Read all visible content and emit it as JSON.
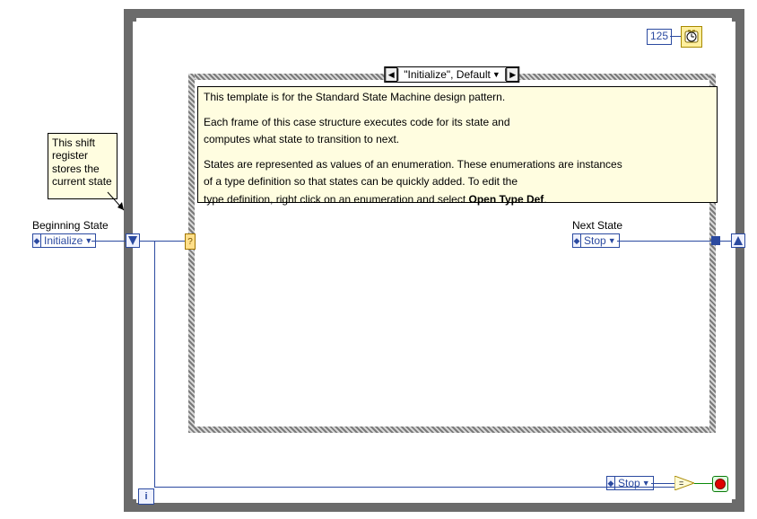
{
  "tip": {
    "text": "This shift register stores the current state"
  },
  "labels": {
    "beginning_state": "Beginning State",
    "next_state": "Next State"
  },
  "enums": {
    "beginning": "Initialize",
    "next": "Stop",
    "compare": "Stop"
  },
  "case_selector": {
    "text": "\"Initialize\", Default"
  },
  "help": {
    "line1": "This template is for the Standard State Machine design pattern.",
    "line2": "Each frame of this case structure executes code for its state and",
    "line3": "computes what state to transition to next.",
    "line4": "States are represented as values of an enumeration. These enumerations are instances",
    "line5": "of a type definition so that states can be quickly added. To edit the",
    "line6_a": "type definition, right click on an enumeration and select ",
    "line6_b": "Open Type Def",
    "line6_c": "."
  },
  "timer": {
    "ms": "125"
  },
  "iteration_glyph": "i",
  "colors": {
    "loop_border": "#6b6b6b",
    "enum_blue": "#2b4aa0",
    "help_bg": "#fffde0",
    "bool_green": "#0a8a0a"
  }
}
